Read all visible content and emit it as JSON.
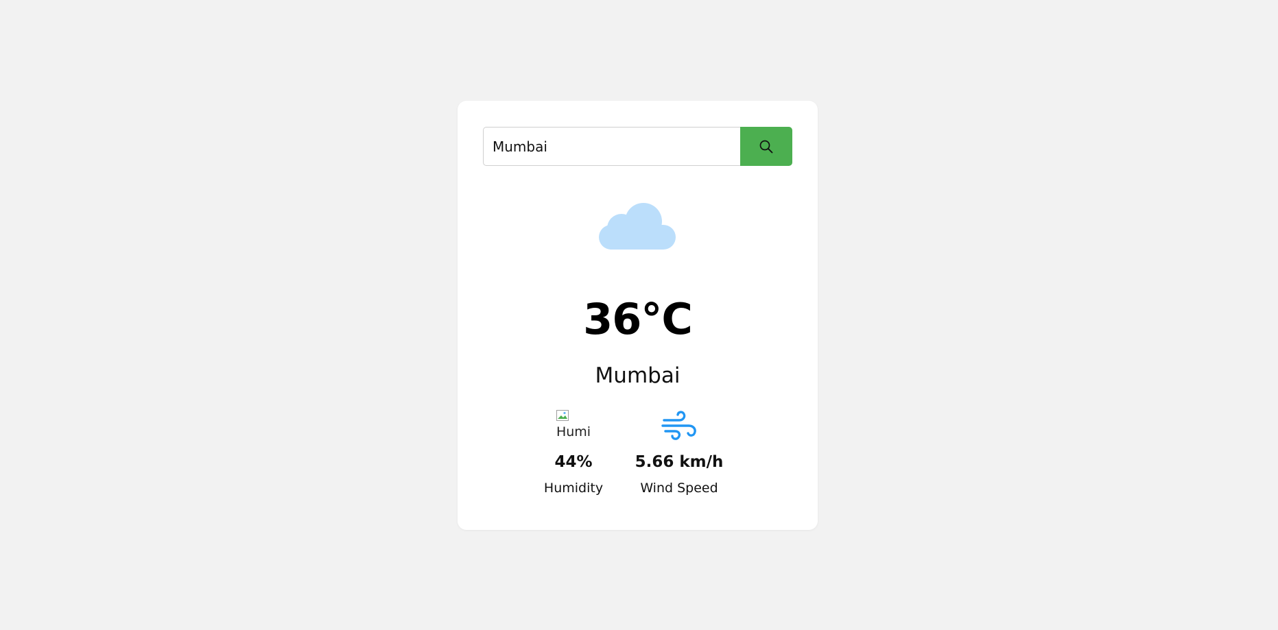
{
  "search": {
    "value": "Mumbai",
    "button_icon": "search-icon"
  },
  "weather": {
    "icon": "cloud-icon",
    "temperature": "36°C",
    "city": "Mumbai"
  },
  "details": {
    "humidity": {
      "icon_alt": "Humi",
      "value": "44%",
      "label": "Humidity"
    },
    "wind": {
      "icon": "wind-icon",
      "value": "5.66 km/h",
      "label": "Wind Speed"
    }
  },
  "colors": {
    "background": "#f2f2f2",
    "card": "#ffffff",
    "search_button": "#4caf50",
    "cloud": "#bbdefb",
    "wind_icon": "#2196f3"
  }
}
